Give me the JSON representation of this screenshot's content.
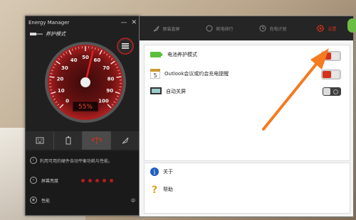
{
  "app": {
    "title": "Energy Manager",
    "minimize": "—",
    "close": "✕",
    "mode": "养护模式"
  },
  "gauge": {
    "ticks": [
      "0",
      "10",
      "20",
      "30",
      "40",
      "50",
      "60",
      "70",
      "80",
      "90",
      "100"
    ],
    "percent_text": "55%",
    "value": 55
  },
  "left_tabs": [
    {
      "name": "tab-smile",
      "icon": "smile-icon"
    },
    {
      "name": "tab-battery",
      "icon": "battery-icon"
    },
    {
      "name": "tab-scale",
      "icon": "scale-icon"
    },
    {
      "name": "tab-rocket",
      "icon": "rocket-icon"
    }
  ],
  "left_info": {
    "description": "利用可用的硬件自动平衡功耗与性能。",
    "brightness_label": "屏幕亮度",
    "performance_label": "性能",
    "performance_value": "中"
  },
  "right_tabs": [
    {
      "label": "原装直屏",
      "icon": "rocket-icon"
    },
    {
      "label": "耗电排行",
      "icon": "bulb-icon"
    },
    {
      "label": "充电计划",
      "icon": "clock-icon"
    },
    {
      "label": "设置",
      "icon": "gear-icon"
    }
  ],
  "settings": [
    {
      "label": "电池养护模式",
      "icon": "battery-icon",
      "state": "on"
    },
    {
      "label": "Outlook会议或约会充电提醒",
      "icon": "calendar-icon",
      "state": "on"
    },
    {
      "label": "自动关屏",
      "icon": "monitor-icon",
      "state": "off"
    }
  ],
  "calendar_day": "5",
  "about": {
    "label": "关于",
    "icon": "info-icon"
  },
  "help": {
    "label": "帮助",
    "icon": "help-icon"
  },
  "colors": {
    "accent": "#d3321a",
    "arrow": "#f47b20",
    "panel": "#202020"
  }
}
